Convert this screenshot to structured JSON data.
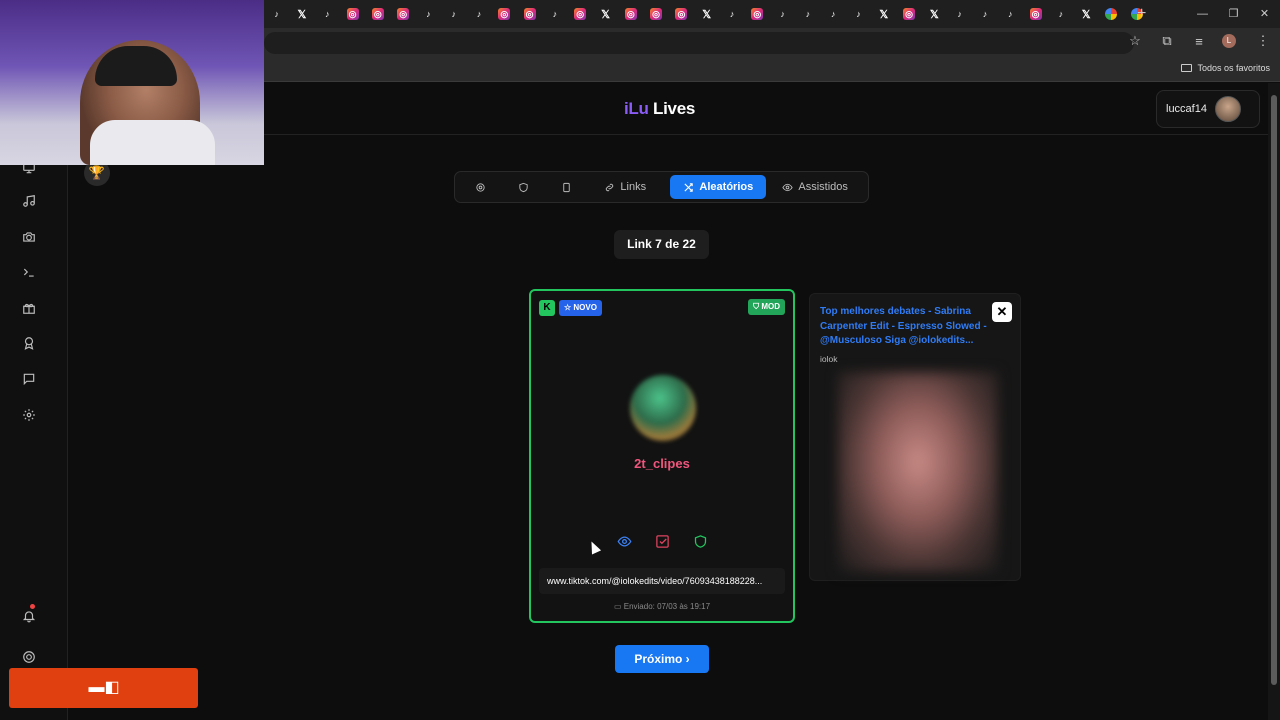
{
  "browser": {
    "tabs": [
      "tiktok",
      "x",
      "tiktok",
      "instagram",
      "instagram",
      "instagram",
      "tiktok",
      "tiktok",
      "tiktok",
      "instagram",
      "instagram",
      "tiktok",
      "instagram",
      "x",
      "instagram",
      "instagram",
      "instagram",
      "x",
      "tiktok",
      "instagram",
      "tiktok",
      "tiktok",
      "tiktok",
      "tiktok",
      "x",
      "instagram",
      "x",
      "tiktok",
      "tiktok",
      "tiktok",
      "instagram",
      "tiktok",
      "x",
      "google",
      "google"
    ],
    "new_tab": "+",
    "bookmarks_folder": "Todos os favoritos",
    "profile_initial": "L"
  },
  "app": {
    "logo_part1": "iLu",
    "logo_part2": "Lives",
    "username": "luccaf14"
  },
  "sidebar": {
    "icons": [
      "monitor-icon",
      "music-icon",
      "camera-icon",
      "terminal-icon",
      "gift-icon",
      "award-icon",
      "chat-icon",
      "settings-icon"
    ],
    "bottom_icons": [
      "bell-icon",
      "help-icon"
    ]
  },
  "nav": {
    "items": [
      {
        "label": "",
        "icon": "gear-icon"
      },
      {
        "label": "",
        "icon": "shield-icon"
      },
      {
        "label": "",
        "icon": "phone-icon"
      },
      {
        "label": "Links",
        "icon": "link-icon"
      },
      {
        "label": "Aleatórios",
        "icon": "shuffle-icon",
        "active": true
      },
      {
        "label": "Assistidos",
        "icon": "eye-icon"
      }
    ]
  },
  "counter": "Link 7 de 22",
  "card": {
    "badge_k": "K",
    "badge_novo": "☆ NOVO",
    "badge_mod": "⛉ MOD",
    "handle": "2t_clipes",
    "url": "www.tiktok.com/@iolokedits/video/76093438188228...",
    "sent": "Enviado: 07/03 às 19:17",
    "border_color": "#22c55e"
  },
  "preview": {
    "title": "Top melhores debates - Sabrina Carpenter Edit - Espresso Slowed - @Musculoso Siga @iolokedits...",
    "author": "iolok",
    "close": "✕"
  },
  "next_button": "Próximo ›",
  "colors": {
    "accent": "#1877f2",
    "handle": "#f0567d",
    "logo": "#8b5cf6",
    "stream": "#e0400f"
  }
}
